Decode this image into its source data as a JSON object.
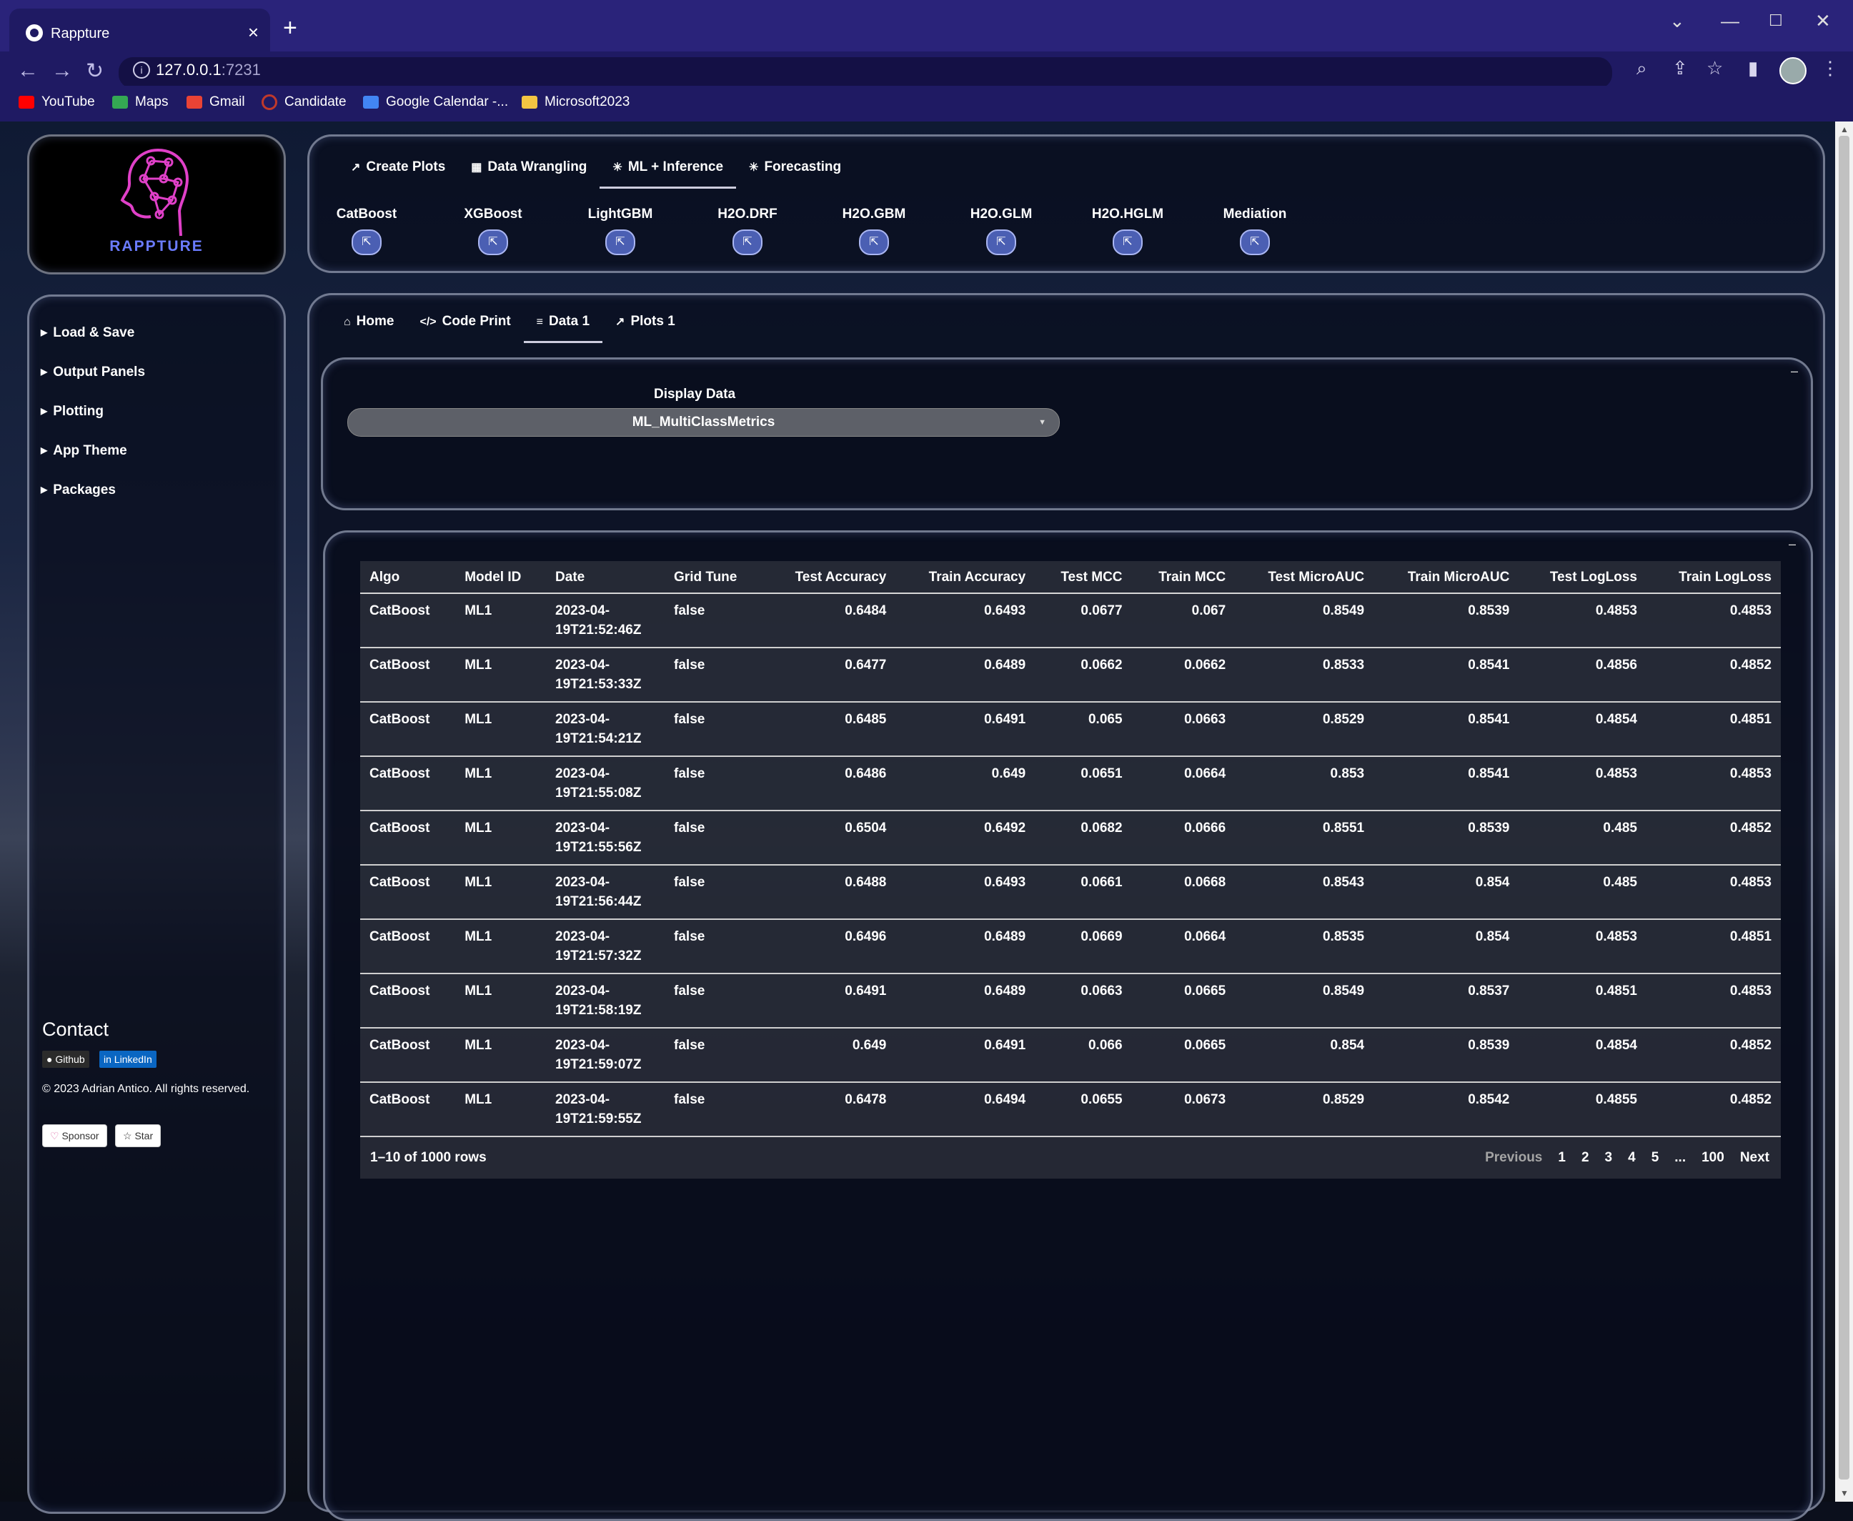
{
  "browser": {
    "tab_title": "Rappture",
    "tab_close": "×",
    "new_tab": "+",
    "url_host": "127.0.0.1",
    "url_port": ":7231",
    "bookmarks": [
      {
        "label": "YouTube",
        "color": "#ff0000"
      },
      {
        "label": "Maps",
        "color": "#34a853"
      },
      {
        "label": "Gmail",
        "color": "#ea4335"
      },
      {
        "label": "Candidate",
        "color": "#c0392b"
      },
      {
        "label": "Google Calendar -...",
        "color": "#4285f4"
      },
      {
        "label": "Microsoft2023",
        "color": "#f4c542"
      }
    ]
  },
  "logo": {
    "text": "RAPPTURE",
    "color": "#6b7cff"
  },
  "sidebar": {
    "items": [
      {
        "label": "Load & Save"
      },
      {
        "label": "Output Panels"
      },
      {
        "label": "Plotting"
      },
      {
        "label": "App Theme"
      },
      {
        "label": "Packages"
      }
    ],
    "contact_title": "Contact",
    "github_label": "Github",
    "linkedin_label": "LinkedIn",
    "copyright": "© 2023 Adrian Antico. All rights reserved.",
    "sponsor_label": "Sponsor",
    "star_label": "Star"
  },
  "topnav": {
    "tabs": [
      {
        "label": "Create Plots",
        "icon": "line-chart-icon"
      },
      {
        "label": "Data Wrangling",
        "icon": "table-icon"
      },
      {
        "label": "ML + Inference",
        "icon": "asterisk-icon"
      },
      {
        "label": "Forecasting",
        "icon": "asterisk-icon"
      }
    ],
    "active_tab": "ML + Inference",
    "models": [
      "CatBoost",
      "XGBoost",
      "LightGBM",
      "H2O.DRF",
      "H2O.GBM",
      "H2O.GLM",
      "H2O.HGLM",
      "Mediation"
    ]
  },
  "subtabs": {
    "tabs": [
      {
        "label": "Home",
        "icon": "home-icon"
      },
      {
        "label": "Code Print",
        "icon": "code-icon"
      },
      {
        "label": "Data 1",
        "icon": "database-icon"
      },
      {
        "label": "Plots 1",
        "icon": "line-chart-icon"
      }
    ],
    "active_tab": "Data 1"
  },
  "display": {
    "label": "Display Data",
    "selected": "ML_MultiClassMetrics",
    "minimize": "–"
  },
  "table": {
    "columns": [
      "Algo",
      "Model ID",
      "Date",
      "Grid Tune",
      "Test Accuracy",
      "Train Accuracy",
      "Test MCC",
      "Train MCC",
      "Test MicroAUC",
      "Train MicroAUC",
      "Test LogLoss",
      "Train LogLoss"
    ],
    "rows": [
      [
        "CatBoost",
        "ML1",
        "2023-04-19T21:52:46Z",
        "false",
        "0.6484",
        "0.6493",
        "0.0677",
        "0.067",
        "0.8549",
        "0.8539",
        "0.4853",
        "0.4853"
      ],
      [
        "CatBoost",
        "ML1",
        "2023-04-19T21:53:33Z",
        "false",
        "0.6477",
        "0.6489",
        "0.0662",
        "0.0662",
        "0.8533",
        "0.8541",
        "0.4856",
        "0.4852"
      ],
      [
        "CatBoost",
        "ML1",
        "2023-04-19T21:54:21Z",
        "false",
        "0.6485",
        "0.6491",
        "0.065",
        "0.0663",
        "0.8529",
        "0.8541",
        "0.4854",
        "0.4851"
      ],
      [
        "CatBoost",
        "ML1",
        "2023-04-19T21:55:08Z",
        "false",
        "0.6486",
        "0.649",
        "0.0651",
        "0.0664",
        "0.853",
        "0.8541",
        "0.4853",
        "0.4853"
      ],
      [
        "CatBoost",
        "ML1",
        "2023-04-19T21:55:56Z",
        "false",
        "0.6504",
        "0.6492",
        "0.0682",
        "0.0666",
        "0.8551",
        "0.8539",
        "0.485",
        "0.4852"
      ],
      [
        "CatBoost",
        "ML1",
        "2023-04-19T21:56:44Z",
        "false",
        "0.6488",
        "0.6493",
        "0.0661",
        "0.0668",
        "0.8543",
        "0.854",
        "0.485",
        "0.4853"
      ],
      [
        "CatBoost",
        "ML1",
        "2023-04-19T21:57:32Z",
        "false",
        "0.6496",
        "0.6489",
        "0.0669",
        "0.0664",
        "0.8535",
        "0.854",
        "0.4853",
        "0.4851"
      ],
      [
        "CatBoost",
        "ML1",
        "2023-04-19T21:58:19Z",
        "false",
        "0.6491",
        "0.6489",
        "0.0663",
        "0.0665",
        "0.8549",
        "0.8537",
        "0.4851",
        "0.4853"
      ],
      [
        "CatBoost",
        "ML1",
        "2023-04-19T21:59:07Z",
        "false",
        "0.649",
        "0.6491",
        "0.066",
        "0.0665",
        "0.854",
        "0.8539",
        "0.4854",
        "0.4852"
      ],
      [
        "CatBoost",
        "ML1",
        "2023-04-19T21:59:55Z",
        "false",
        "0.6478",
        "0.6494",
        "0.0655",
        "0.0673",
        "0.8529",
        "0.8542",
        "0.4855",
        "0.4852"
      ]
    ],
    "rows_info": "1–10 of 1000 rows",
    "pager": {
      "previous": "Previous",
      "pages": [
        "1",
        "2",
        "3",
        "4",
        "5",
        "...",
        "100"
      ],
      "next": "Next"
    }
  }
}
